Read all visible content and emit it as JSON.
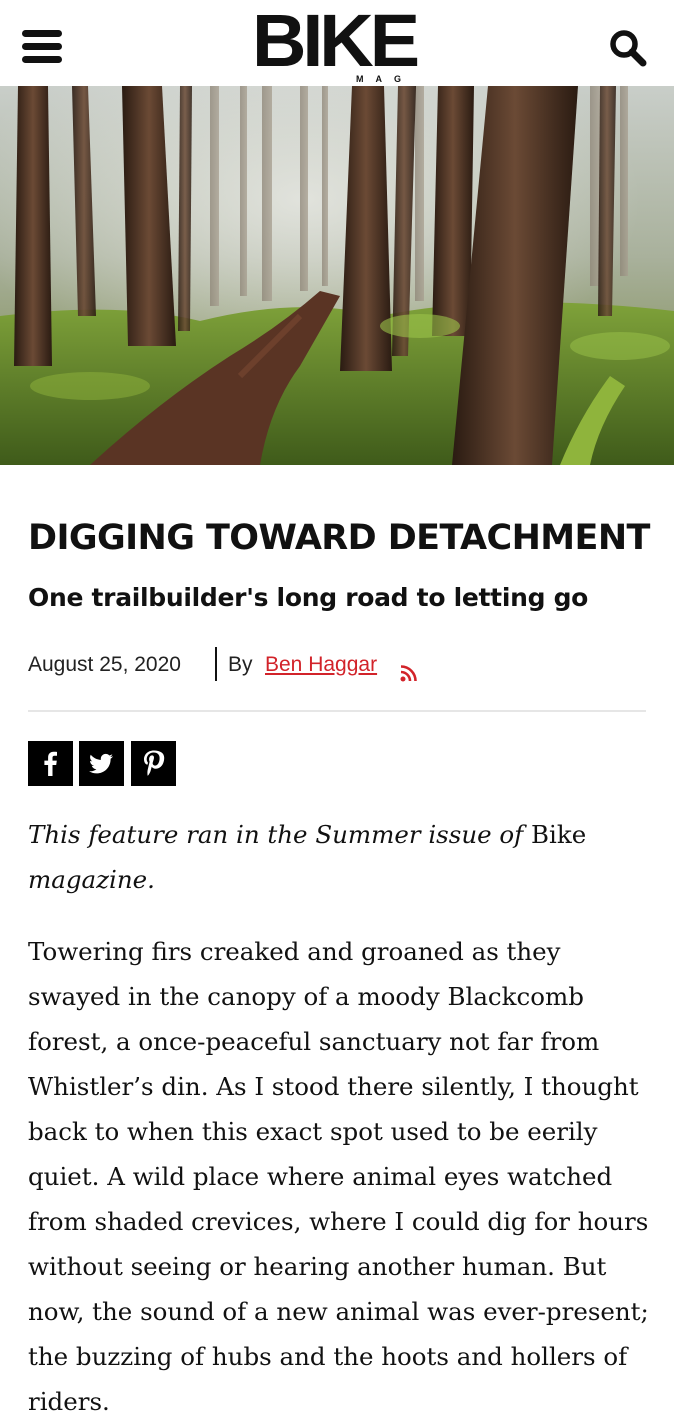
{
  "header": {
    "logo_main": "BIKE",
    "logo_sub": "MAG"
  },
  "hero": {
    "description_icon": "forest-trail-photo"
  },
  "article": {
    "title": "DIGGING TOWARD DETACHMENT",
    "subtitle": "One trailbuilder's long road to letting go",
    "date": "August 25, 2020",
    "by_label": "By",
    "author": "Ben Haggar",
    "share": {
      "facebook_icon": "facebook-icon",
      "twitter_icon": "twitter-icon",
      "pinterest_icon": "pinterest-icon"
    },
    "intro_italic_1": "This feature ran in the Summer issue of",
    "intro_plain": "Bike",
    "intro_italic_2": "magazine.",
    "paragraph_1": "Towering firs creaked and groaned as they swayed in the canopy of a moody Blackcomb forest, a once-peaceful sanctuary not far from Whistler’s din. As I stood there silently, I thought back to when this exact spot used to be eerily quiet. A wild place where animal eyes watched from shaded crevices, where I could dig for hours without seeing or hearing another human. But now, the sound of a new animal was ever-present; the buzzing of hubs and the hoots and hollers of riders."
  },
  "colors": {
    "author_link": "#d2232a",
    "text": "#111111",
    "divider": "#e6e6e6"
  }
}
